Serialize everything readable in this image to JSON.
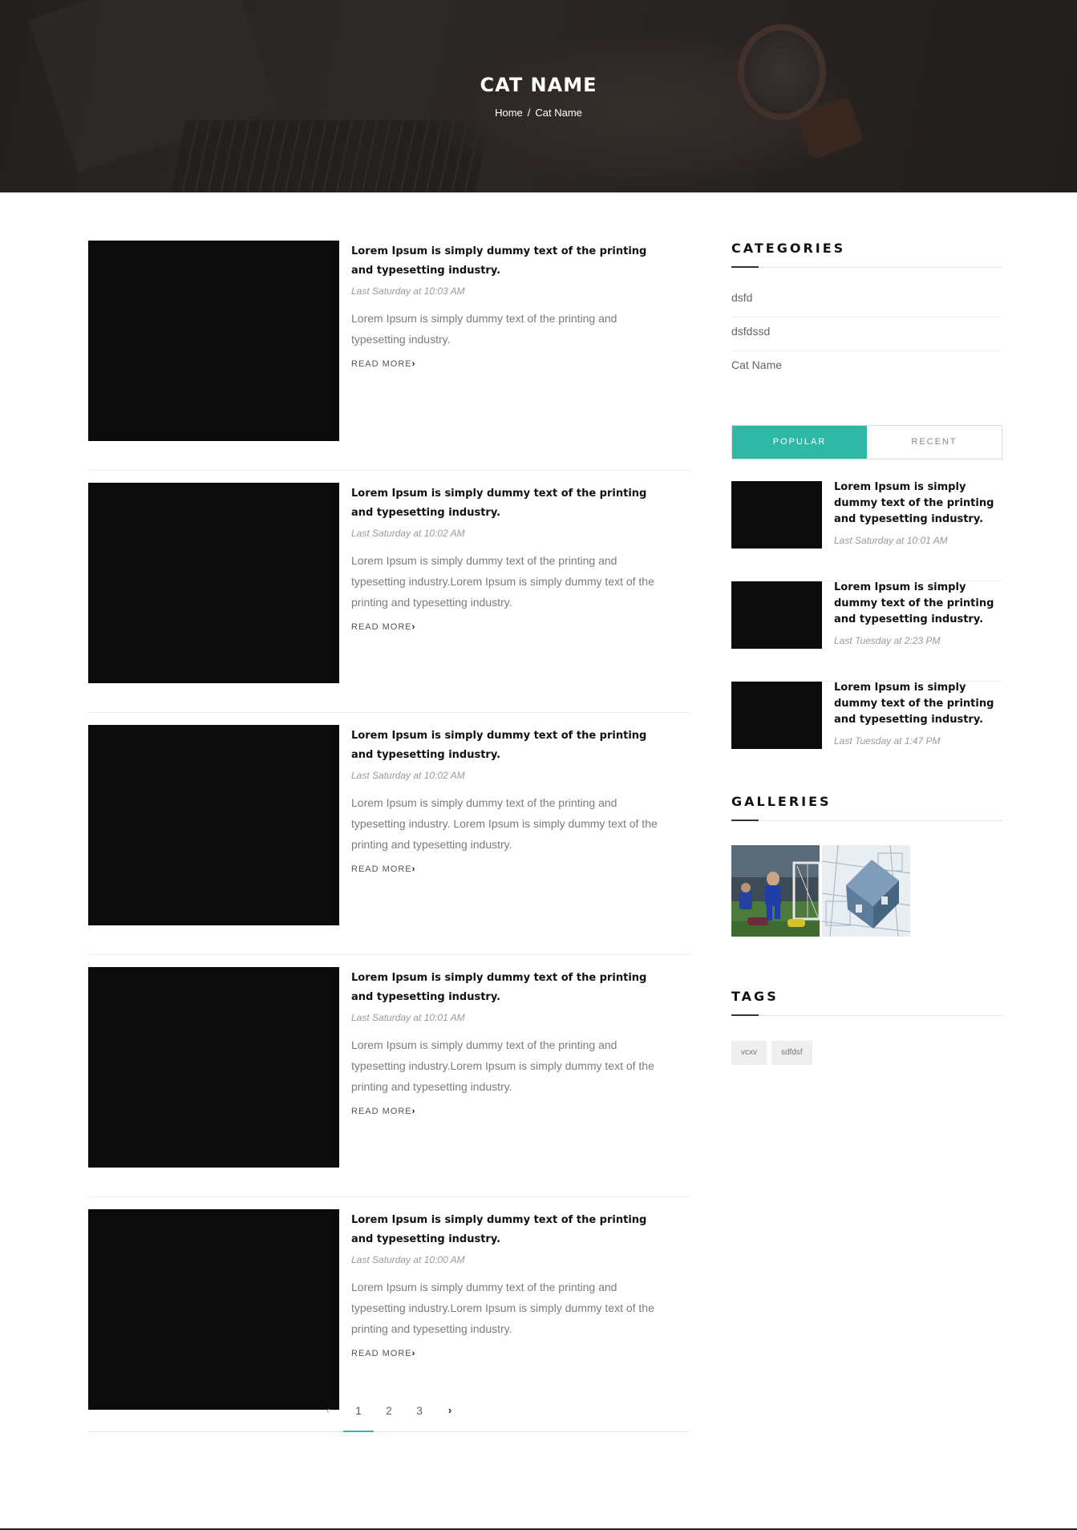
{
  "hero": {
    "title": "CAT NAME",
    "breadcrumb": {
      "home": "Home",
      "separator": "/",
      "current": "Cat Name"
    }
  },
  "posts": [
    {
      "title": "Lorem Ipsum is simply dummy text of the printing and typesetting industry.",
      "date": "Last Saturday at 10:03 AM",
      "excerpt": "Lorem Ipsum is simply dummy text of the printing and typesetting industry.",
      "read_more": "READ MORE"
    },
    {
      "title": "Lorem Ipsum is simply dummy text of the printing and typesetting industry.",
      "date": "Last Saturday at 10:02 AM",
      "excerpt": "Lorem Ipsum is simply dummy text of the printing and typesetting industry.Lorem Ipsum is simply dummy text of the printing and typesetting industry.",
      "read_more": "READ MORE"
    },
    {
      "title": "Lorem Ipsum is simply dummy text of the printing and typesetting industry.",
      "date": "Last Saturday at 10:02 AM",
      "excerpt": "Lorem Ipsum is simply dummy text of the printing and typesetting industry. Lorem Ipsum is simply dummy text of the printing and typesetting industry.",
      "read_more": "READ MORE"
    },
    {
      "title": "Lorem Ipsum is simply dummy text of the printing and typesetting industry.",
      "date": "Last Saturday at 10:01 AM",
      "excerpt": "Lorem Ipsum is simply dummy text of the printing and typesetting industry.Lorem Ipsum is simply dummy text of the printing and typesetting industry.",
      "read_more": "READ MORE"
    },
    {
      "title": "Lorem Ipsum is simply dummy text of the printing and typesetting industry.",
      "date": "Last Saturday at 10:00 AM",
      "excerpt": "Lorem Ipsum is simply dummy text of the printing and typesetting industry.Lorem Ipsum is simply dummy text of the printing and typesetting industry.",
      "read_more": "READ MORE"
    }
  ],
  "pagination": {
    "prev": "‹",
    "pages": [
      "1",
      "2",
      "3"
    ],
    "active_page": "1",
    "next": "›"
  },
  "sidebar": {
    "categories": {
      "title": "CATEGORIES",
      "items": [
        "dsfd",
        "dsfdssd",
        "Cat Name"
      ]
    },
    "tabs": {
      "popular": "POPULAR",
      "recent": "RECENT",
      "active": "popular"
    },
    "popular_posts": [
      {
        "title": "Lorem Ipsum is simply dummy text of the printing and typesetting industry.",
        "date": "Last Saturday at 10:01 AM"
      },
      {
        "title": "Lorem Ipsum is simply dummy text of the printing and typesetting industry.",
        "date": "Last Tuesday at 2:23 PM"
      },
      {
        "title": "Lorem Ipsum is simply dummy text of the printing and typesetting industry.",
        "date": "Last Tuesday at 1:47 PM"
      }
    ],
    "galleries": {
      "title": "GALLERIES",
      "images": [
        "football-photo",
        "house-blueprint-photo"
      ]
    },
    "tags": {
      "title": "TAGS",
      "items": [
        "vcxv",
        "sdfdsf"
      ]
    }
  },
  "colors": {
    "accent": "#2fb8a5",
    "thumb_placeholder": "#0b0b0b",
    "hero_overlay": "#2b2928"
  }
}
